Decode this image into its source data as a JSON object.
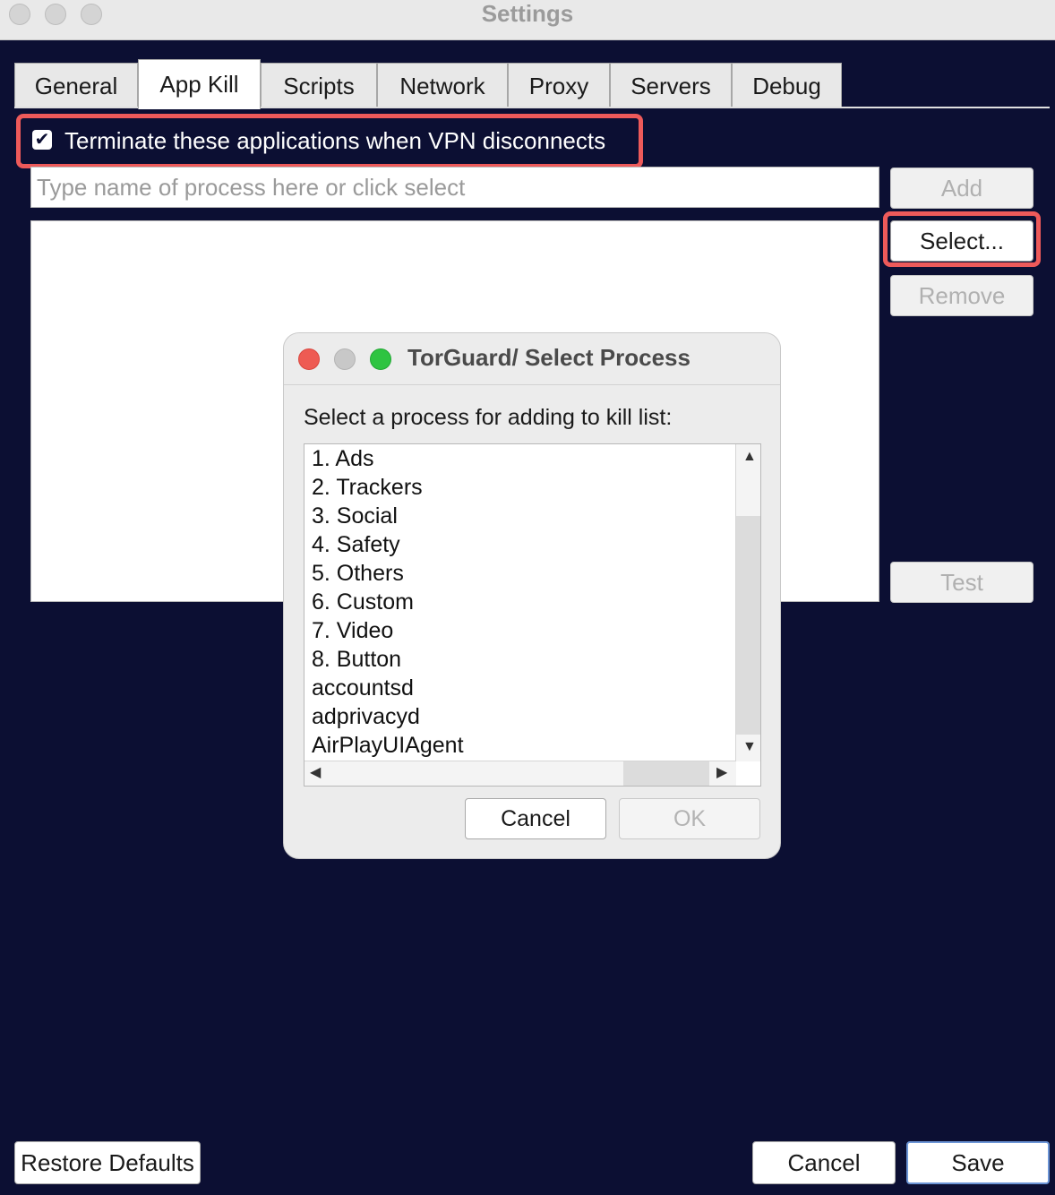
{
  "window": {
    "title": "Settings"
  },
  "tabs": [
    {
      "label": "General",
      "active": false
    },
    {
      "label": "App Kill",
      "active": true
    },
    {
      "label": "Scripts",
      "active": false
    },
    {
      "label": "Network",
      "active": false
    },
    {
      "label": "Proxy",
      "active": false
    },
    {
      "label": "Servers",
      "active": false
    },
    {
      "label": "Debug",
      "active": false
    }
  ],
  "appkill": {
    "terminate_label": "Terminate these applications when VPN disconnects",
    "terminate_checked": true,
    "process_placeholder": "Type name of process here or click select",
    "process_value": "",
    "add_label": "Add",
    "select_label": "Select...",
    "remove_label": "Remove",
    "test_label": "Test"
  },
  "footer": {
    "restore_label": "Restore Defaults",
    "cancel_label": "Cancel",
    "save_label": "Save"
  },
  "dialog": {
    "title": "TorGuard/ Select Process",
    "prompt": "Select a process for adding to kill list:",
    "items": [
      "1. Ads",
      "2. Trackers",
      "3. Social",
      "4. Safety",
      "5. Others",
      "6. Custom",
      "7. Video",
      "8. Button",
      "accountsd",
      "adprivacyd",
      "AirPlayUIAgent"
    ],
    "cancel_label": "Cancel",
    "ok_label": "OK"
  },
  "colors": {
    "background": "#0c0f33",
    "highlight": "#ee5a5a",
    "close": "#ee5b53",
    "minimize": "#c8c8c8",
    "zoom": "#2ec441",
    "default_button_border": "#6c95d6"
  }
}
